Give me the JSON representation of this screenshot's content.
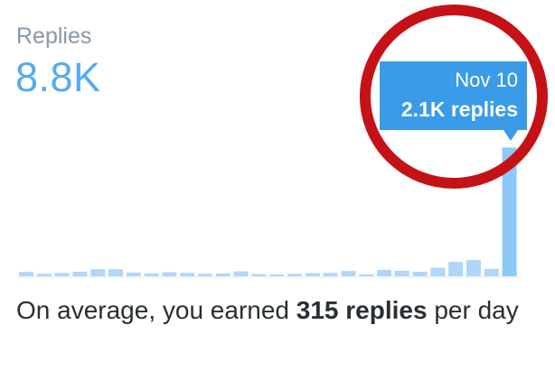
{
  "header": {
    "label": "Replies",
    "total": "8.8K"
  },
  "tooltip": {
    "date": "Nov 10",
    "value": "2.1K replies"
  },
  "summary": {
    "prefix": "On average, you earned ",
    "highlight": "315 replies",
    "suffix": " per day"
  },
  "colors": {
    "bar": "#aed7fa",
    "bar_highlight": "#8cc9f7",
    "tooltip": "#3a9be8",
    "value_text": "#55acee",
    "circle": "#c41217",
    "axis": "#e1e8ed"
  },
  "chart_data": {
    "type": "bar",
    "series": [
      {
        "values": [
          70,
          40,
          55,
          75,
          115,
          115,
          60,
          45,
          65,
          55,
          40,
          45,
          80,
          35,
          30,
          40,
          50,
          55,
          85,
          30,
          105,
          90,
          75,
          140,
          235,
          265,
          120,
          2100
        ]
      }
    ],
    "highlight_index": 27,
    "ylim": [
      0,
      2150
    ],
    "grid": false
  }
}
